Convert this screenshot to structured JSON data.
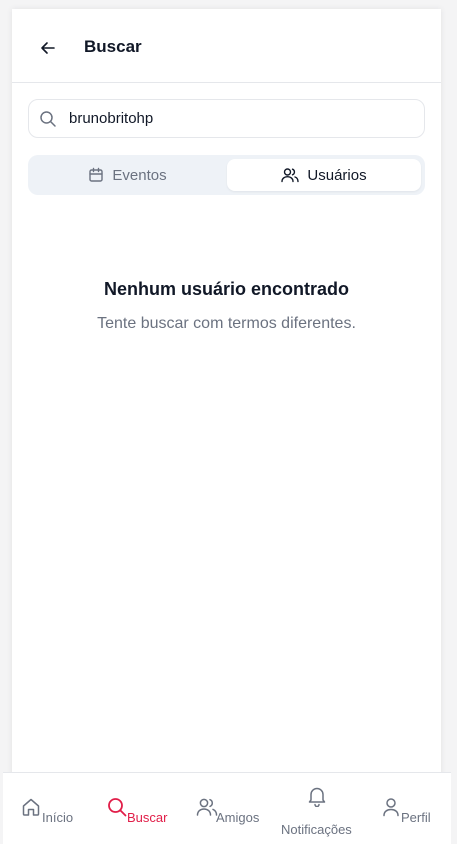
{
  "header": {
    "title": "Buscar"
  },
  "search": {
    "value": "brunobritohp",
    "placeholder": ""
  },
  "tabs": [
    {
      "label": "Eventos",
      "icon": "calendar-icon",
      "active": false
    },
    {
      "label": "Usuários",
      "icon": "users-icon",
      "active": true
    }
  ],
  "empty_state": {
    "title": "Nenhum usuário encontrado",
    "subtitle": "Tente buscar com termos diferentes."
  },
  "bottom_nav": {
    "items": [
      {
        "label": "Início",
        "icon": "home-icon",
        "active": false
      },
      {
        "label": "Buscar",
        "icon": "search-icon",
        "active": true
      },
      {
        "label": "Amigos",
        "icon": "users-icon",
        "active": false
      },
      {
        "label": "Notificações",
        "icon": "bell-icon",
        "active": false
      },
      {
        "label": "Perfil",
        "icon": "user-icon",
        "active": false
      }
    ]
  },
  "colors": {
    "accent": "#e11d48",
    "muted": "#6b7280",
    "text": "#111827",
    "tabs_bg": "#eef2f7"
  }
}
